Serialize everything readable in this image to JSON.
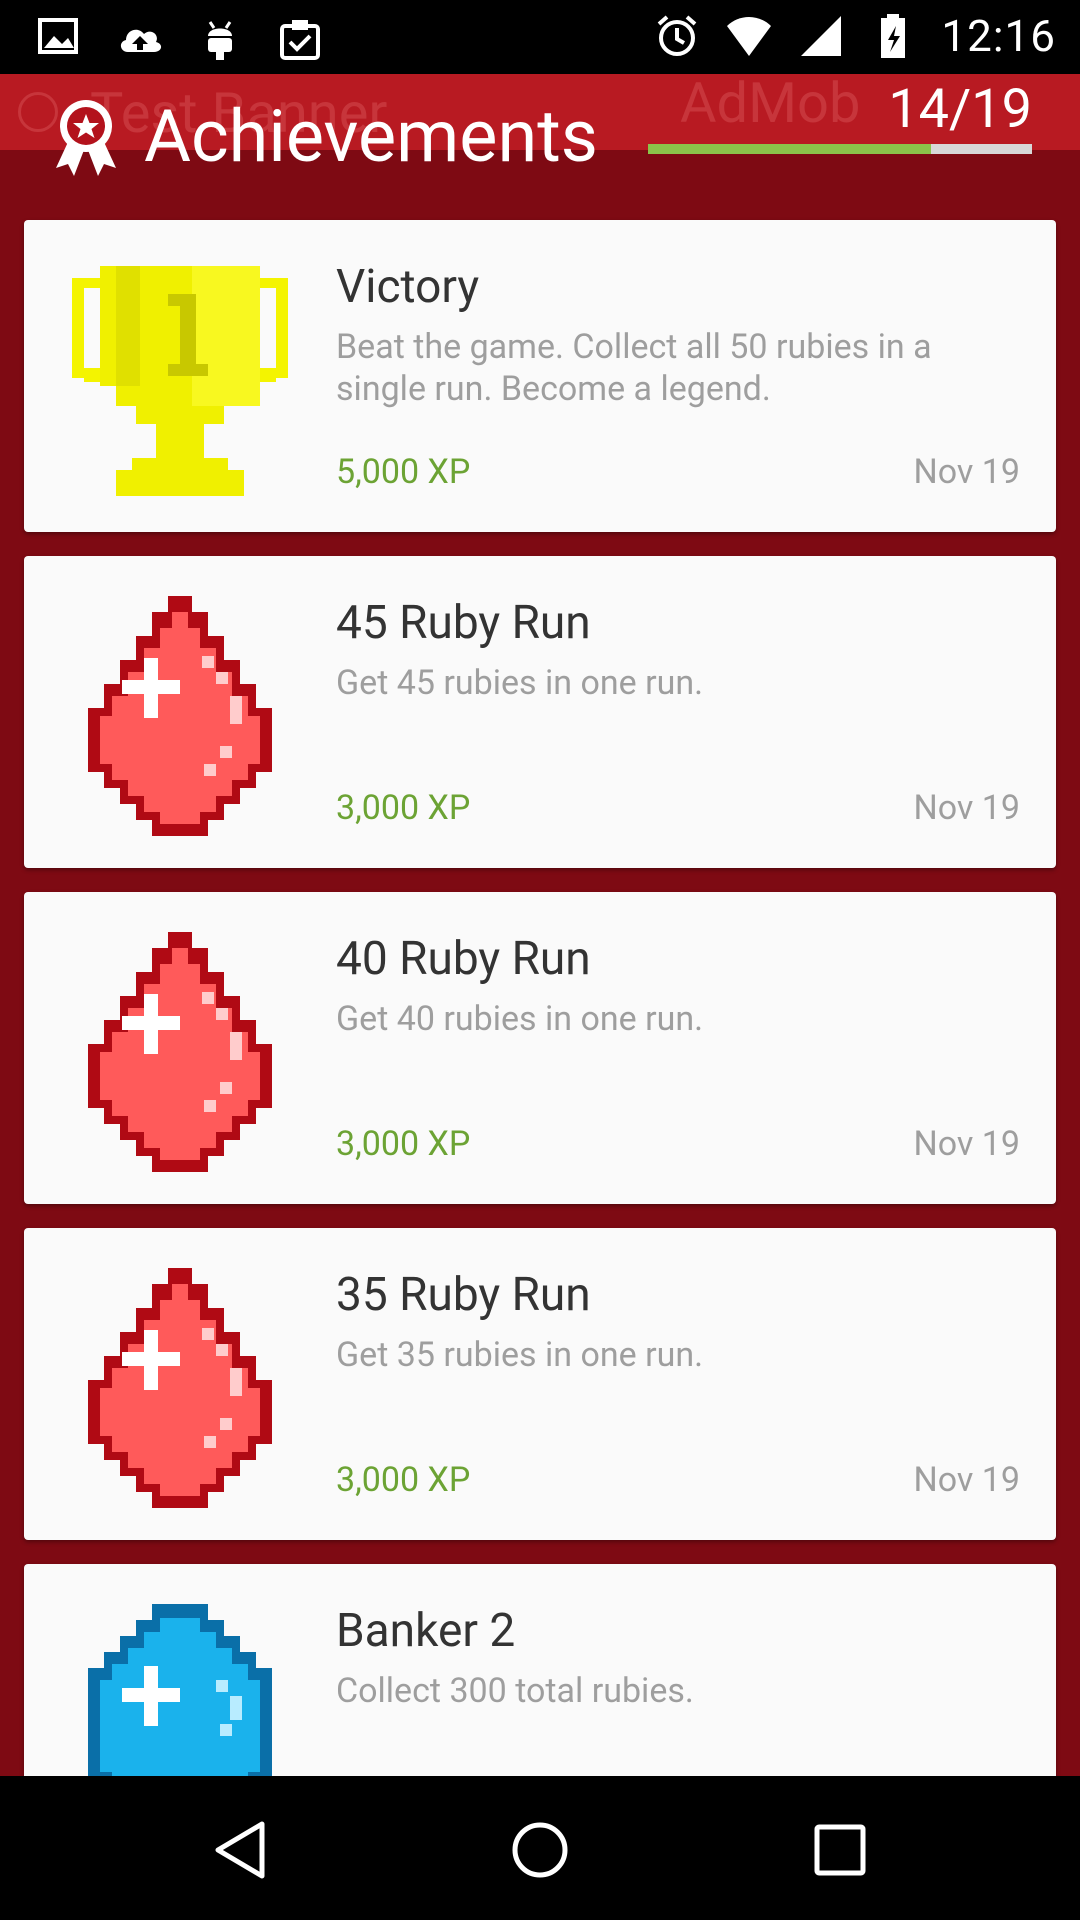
{
  "status_bar": {
    "time": "12:16",
    "left_icons": [
      "image-icon",
      "cloud-upload-icon",
      "android-icon",
      "clipboard-check-icon"
    ],
    "right_icons": [
      "alarm-icon",
      "wifi-icon",
      "signal-icon",
      "battery-icon"
    ]
  },
  "ad": {
    "left_text": "Test Banner",
    "right_text": "AdMob"
  },
  "header": {
    "title": "Achievements",
    "count": "14/19",
    "progress_fraction": 0.737
  },
  "achievements": [
    {
      "name": "Victory",
      "description": "Beat the game. Collect all 50 rubies in a single run. Become a legend.",
      "xp": "5,000 XP",
      "date": "Nov 19",
      "icon": "trophy-icon"
    },
    {
      "name": "45 Ruby Run",
      "description": "Get 45 rubies in one run.",
      "xp": "3,000 XP",
      "date": "Nov 19",
      "icon": "ruby-icon"
    },
    {
      "name": "40 Ruby Run",
      "description": "Get 40 rubies in one run.",
      "xp": "3,000 XP",
      "date": "Nov 19",
      "icon": "ruby-icon"
    },
    {
      "name": "35 Ruby Run",
      "description": "Get 35 rubies in one run.",
      "xp": "3,000 XP",
      "date": "Nov 19",
      "icon": "ruby-icon"
    },
    {
      "name": "Banker 2",
      "description": "Collect 300 total rubies.",
      "xp": "",
      "date": "",
      "icon": "sapphire-icon"
    }
  ],
  "colors": {
    "background": "#7e0a13",
    "xp_green": "#6ca334",
    "progress_green": "#8bc34a"
  }
}
